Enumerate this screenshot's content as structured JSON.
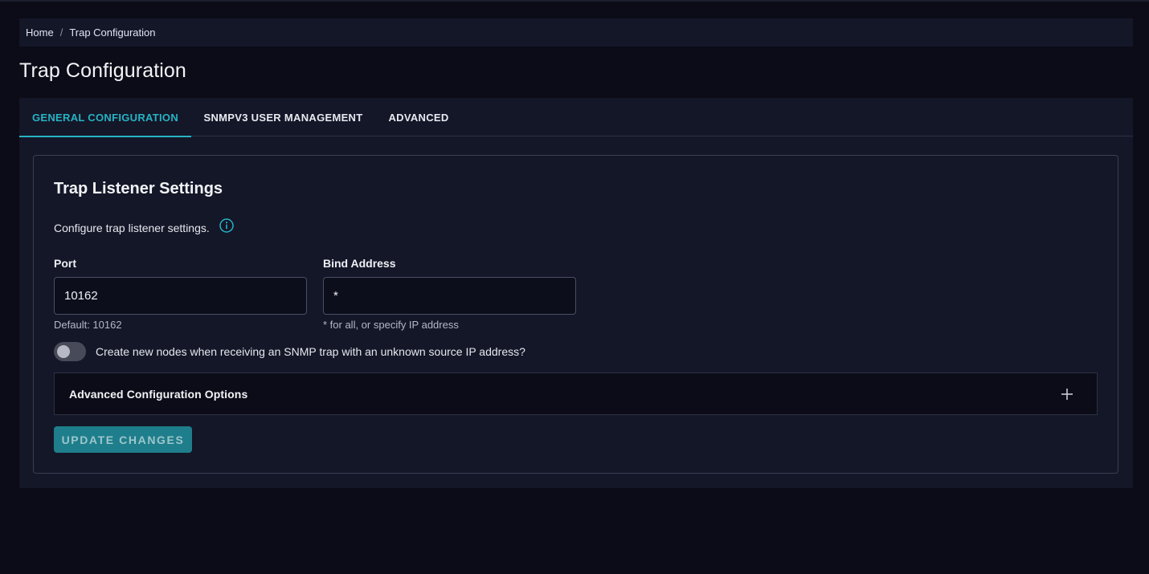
{
  "breadcrumb": {
    "items": [
      {
        "label": "Home"
      },
      {
        "label": "Trap Configuration"
      }
    ],
    "separator": "/"
  },
  "page": {
    "title": "Trap Configuration"
  },
  "tabs": [
    {
      "label": "GENERAL CONFIGURATION",
      "active": true
    },
    {
      "label": "SNMPV3 USER MANAGEMENT",
      "active": false
    },
    {
      "label": "ADVANCED",
      "active": false
    }
  ],
  "card": {
    "title": "Trap Listener Settings",
    "description": "Configure trap listener settings."
  },
  "port": {
    "label": "Port",
    "value": "10162",
    "helper": "Default: 10162"
  },
  "bind_address": {
    "label": "Bind Address",
    "value": "*",
    "helper": "* for all, or specify IP address"
  },
  "create_nodes_toggle": {
    "label": "Create new nodes when receiving an SNMP trap with an unknown source IP address?",
    "enabled": false
  },
  "advanced_options": {
    "label": "Advanced Configuration Options"
  },
  "actions": {
    "update_label": "UPDATE CHANGES"
  },
  "colors": {
    "background": "#0b0c17",
    "panel": "#141728",
    "accent": "#26b3c4",
    "button": "#1f7e8b"
  }
}
